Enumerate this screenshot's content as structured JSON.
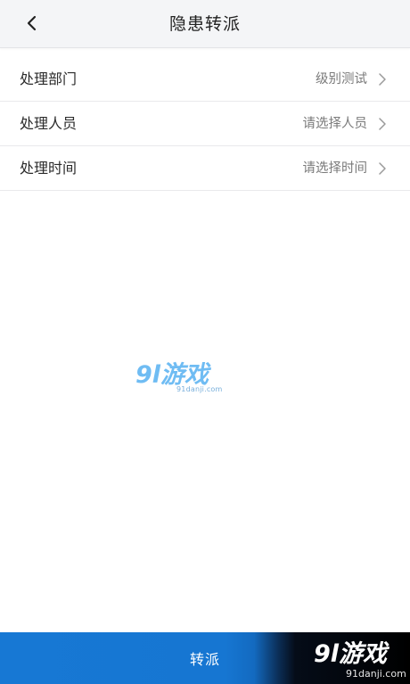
{
  "header": {
    "title": "隐患转派",
    "back_icon": "chevron-left-icon"
  },
  "form": {
    "rows": [
      {
        "label": "处理部门",
        "value": "级别测试"
      },
      {
        "label": "处理人员",
        "value": "请选择人员"
      },
      {
        "label": "处理时间",
        "value": "请选择时间"
      }
    ]
  },
  "watermark": {
    "logo_text": "9l游戏",
    "sub_text": "91danji.com"
  },
  "bottom_bar": {
    "button_label": "转派",
    "corner_logo_text": "9l游戏",
    "corner_logo_sub": "91danji.com"
  },
  "colors": {
    "header_bg": "#f4f5f7",
    "button_blue": "#1778d4",
    "label_text": "#2b2b2b",
    "value_text": "#7a7a7a"
  }
}
